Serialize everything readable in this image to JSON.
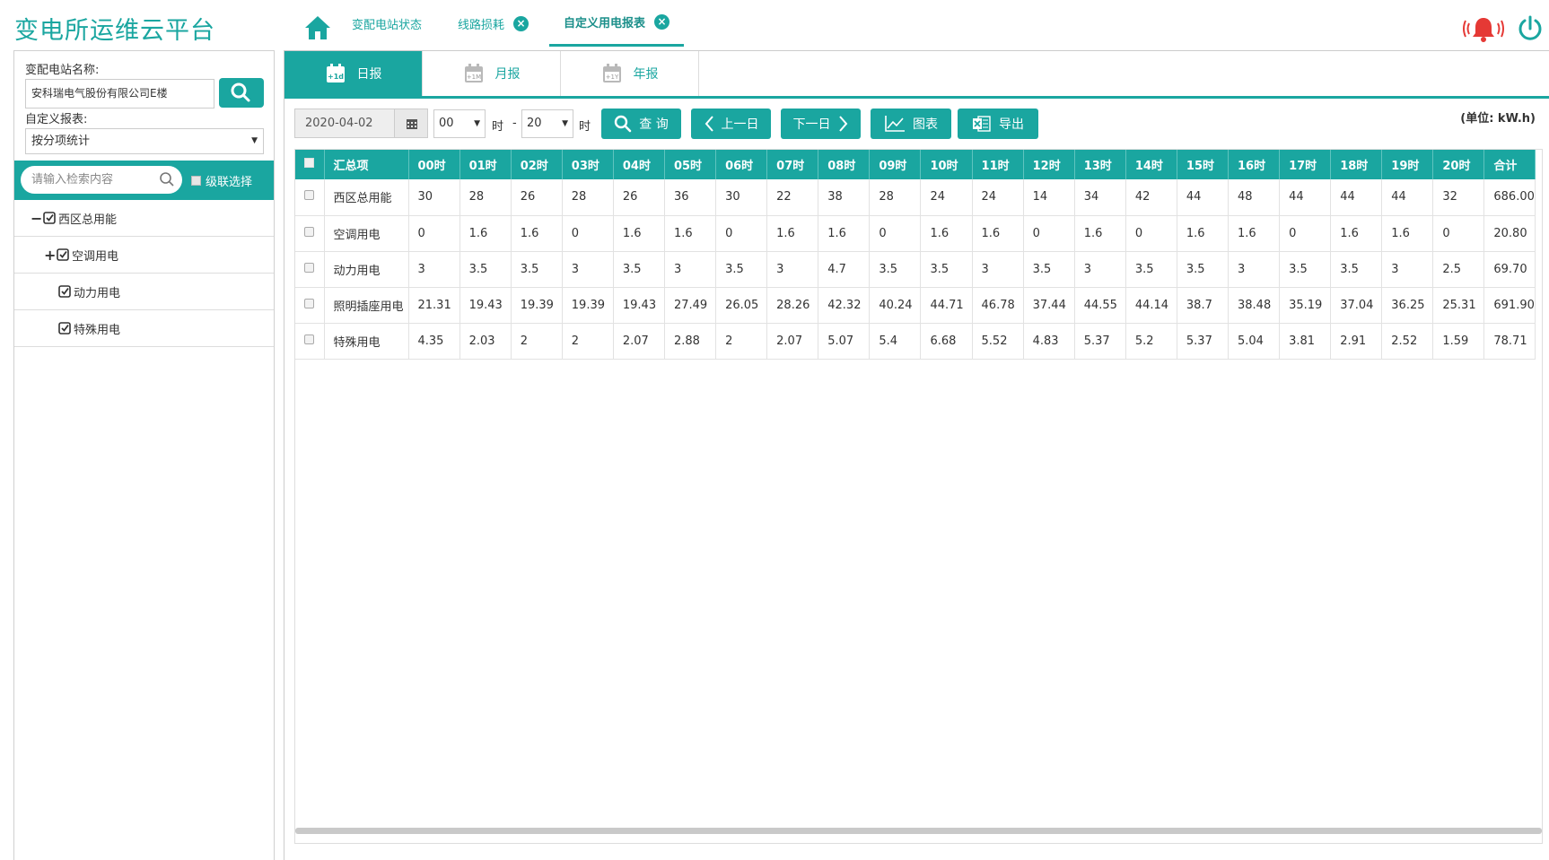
{
  "app": {
    "title": "变电所运维云平台"
  },
  "header": {
    "tabs": [
      {
        "label": "变配电站状态",
        "closable": false,
        "active": false
      },
      {
        "label": "线路损耗",
        "closable": true,
        "active": false
      },
      {
        "label": "自定义用电报表",
        "closable": true,
        "active": true
      }
    ],
    "icons": [
      "home-icon",
      "alarm-bell-icon",
      "power-icon"
    ],
    "accent_color": "#1aa6a0",
    "alarm_color": "#e53935"
  },
  "sidebar": {
    "station_label": "变配电站名称:",
    "station_value": "安科瑞电气股份有限公司E楼",
    "report_label": "自定义报表:",
    "report_value": "按分项统计",
    "search_placeholder": "请输入检索内容",
    "cascade_label": "级联选择",
    "tree": [
      {
        "label": "西区总用能",
        "toggle": "−",
        "checked": true
      },
      {
        "label": "空调用电",
        "toggle": "+",
        "checked": true
      },
      {
        "label": "动力用电",
        "toggle": "",
        "checked": true
      },
      {
        "label": "特殊用电",
        "toggle": "",
        "checked": true
      }
    ]
  },
  "main": {
    "report_tabs": [
      {
        "label": "日报",
        "icon_text": "+1d",
        "active": true
      },
      {
        "label": "月报",
        "icon_text": "+1M",
        "active": false
      },
      {
        "label": "年报",
        "icon_text": "+1Y",
        "active": false
      }
    ],
    "toolbar": {
      "date": "2020-04-02",
      "hour_from": "00",
      "hour_to": "20",
      "hour_unit": "时",
      "dash": "-",
      "query": "查 询",
      "prev_day": "上一日",
      "next_day": "下一日",
      "chart": "图表",
      "export": "导出",
      "unit": "(单位: kW.h)"
    },
    "table": {
      "headers": [
        "汇总项",
        "00时",
        "01时",
        "02时",
        "03时",
        "04时",
        "05时",
        "06时",
        "07时",
        "08时",
        "09时",
        "10时",
        "11时",
        "12时",
        "13时",
        "14时",
        "15时",
        "16时",
        "17时",
        "18时",
        "19时",
        "20时",
        "合计"
      ],
      "rows": [
        [
          "西区总用能",
          "30",
          "28",
          "26",
          "28",
          "26",
          "36",
          "30",
          "22",
          "38",
          "28",
          "24",
          "24",
          "14",
          "34",
          "42",
          "44",
          "48",
          "44",
          "44",
          "44",
          "32",
          "686.00"
        ],
        [
          "空调用电",
          "0",
          "1.6",
          "1.6",
          "0",
          "1.6",
          "1.6",
          "0",
          "1.6",
          "1.6",
          "0",
          "1.6",
          "1.6",
          "0",
          "1.6",
          "0",
          "1.6",
          "1.6",
          "0",
          "1.6",
          "1.6",
          "0",
          "20.80"
        ],
        [
          "动力用电",
          "3",
          "3.5",
          "3.5",
          "3",
          "3.5",
          "3",
          "3.5",
          "3",
          "4.7",
          "3.5",
          "3.5",
          "3",
          "3.5",
          "3",
          "3.5",
          "3.5",
          "3",
          "3.5",
          "3.5",
          "3",
          "2.5",
          "69.70"
        ],
        [
          "照明插座用电",
          "21.31",
          "19.43",
          "19.39",
          "19.39",
          "19.43",
          "27.49",
          "26.05",
          "28.26",
          "42.32",
          "40.24",
          "44.71",
          "46.78",
          "37.44",
          "44.55",
          "44.14",
          "38.7",
          "38.48",
          "35.19",
          "37.04",
          "36.25",
          "25.31",
          "691.90"
        ],
        [
          "特殊用电",
          "4.35",
          "2.03",
          "2",
          "2",
          "2.07",
          "2.88",
          "2",
          "2.07",
          "5.07",
          "5.4",
          "6.68",
          "5.52",
          "4.83",
          "5.37",
          "5.2",
          "5.37",
          "5.04",
          "3.81",
          "2.91",
          "2.52",
          "1.59",
          "78.71"
        ]
      ]
    }
  }
}
